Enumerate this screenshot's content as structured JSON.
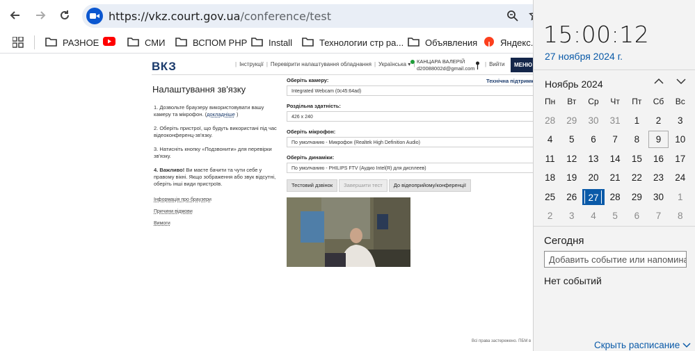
{
  "browser": {
    "url_host": "https://vkz.court.gov.ua",
    "url_path": "/conference/test"
  },
  "bookmarks": [
    {
      "label": "РАЗНОЕ",
      "icon": "folder-icon"
    },
    {
      "label": "",
      "icon": "youtube-icon"
    },
    {
      "label": "СМИ",
      "icon": "folder-icon"
    },
    {
      "label": "ВСПОМ PHP",
      "icon": "folder-icon"
    },
    {
      "label": "Install",
      "icon": "folder-icon"
    },
    {
      "label": "Технологии стр ра...",
      "icon": "folder-icon"
    },
    {
      "label": "Объявления",
      "icon": "folder-icon"
    },
    {
      "label": "Яндекс.П",
      "icon": "yandex-icon"
    }
  ],
  "site": {
    "logo": "ВКЗ",
    "nav": [
      "Інструкції",
      "Перевірити налаштування обладнання",
      "Українська ▾"
    ],
    "user_name": "КАНЦАРА ВАЛЕРІЙ",
    "user_email": "d20088002d@gmail.com",
    "logout": "Вийти",
    "menu": "МЕНЮ",
    "support": "Технічна підтримк"
  },
  "setup": {
    "title": "Налаштування зв'язку",
    "step1_a": "1. Дозвольте браузеру використовувати вашу камеру та мікрофон. (",
    "step1_link": "докладніше",
    "step1_b": " )",
    "step2": "2. Оберіть пристрої, що будуть використані під час відеоконференц-зв'язку.",
    "step3": "3. Натисніть кнопку «Подзвонити» для перевірки зв'язку.",
    "step4_bold": "4. Важливо!",
    "step4": " Ви маєте бачити та чути себе у правому вікні. Якщо зображення або звук відсутні, оберіть інші види пристроїв.",
    "links": [
      "Інформація про браузери",
      "Причини відмови",
      "Вимоги"
    ]
  },
  "form": {
    "camera_label": "Оберіть камеру:",
    "camera_value": "Integrated Webcam (0c45:64ad)",
    "resolution_label": "Роздільна здатність:",
    "resolution_value": "426 x 240",
    "mic_label": "Оберіть мікрофон:",
    "mic_value": "По умолчанию - Микрофон (Realtek High Definition Audio)",
    "speaker_label": "Оберіть динаміки:",
    "speaker_value": "По умолчанию - PHILIPS FTV (Аудио Intel(R) для дисплеев)",
    "btn_test_call": "Тестовий дзвінок",
    "btn_end_test": "Завершити тест",
    "btn_to_conf": "До відеоприйому/конференції"
  },
  "footer": "Всі права застережено. ПБМ в",
  "calendar": {
    "time": "15:00:12",
    "date": "27 ноября 2024 г.",
    "month": "Ноябрь 2024",
    "weekdays": [
      "Пн",
      "Вт",
      "Ср",
      "Чт",
      "Пт",
      "Сб",
      "Вс"
    ],
    "weeks": [
      [
        "28",
        "29",
        "30",
        "31",
        "1",
        "2",
        "3"
      ],
      [
        "4",
        "5",
        "6",
        "7",
        "8",
        "9",
        "10"
      ],
      [
        "11",
        "12",
        "13",
        "14",
        "15",
        "16",
        "17"
      ],
      [
        "18",
        "19",
        "20",
        "21",
        "22",
        "23",
        "24"
      ],
      [
        "25",
        "26",
        "27",
        "28",
        "29",
        "30",
        "1"
      ],
      [
        "2",
        "3",
        "4",
        "5",
        "6",
        "7",
        "8"
      ]
    ],
    "today_label": "Сегодня",
    "event_placeholder": "Добавить событие или напоминание",
    "no_events": "Нет событий",
    "hide_schedule": "Скрыть расписание"
  },
  "colors": {
    "accent": "#0a5aa8",
    "site_navy": "#14264a"
  }
}
